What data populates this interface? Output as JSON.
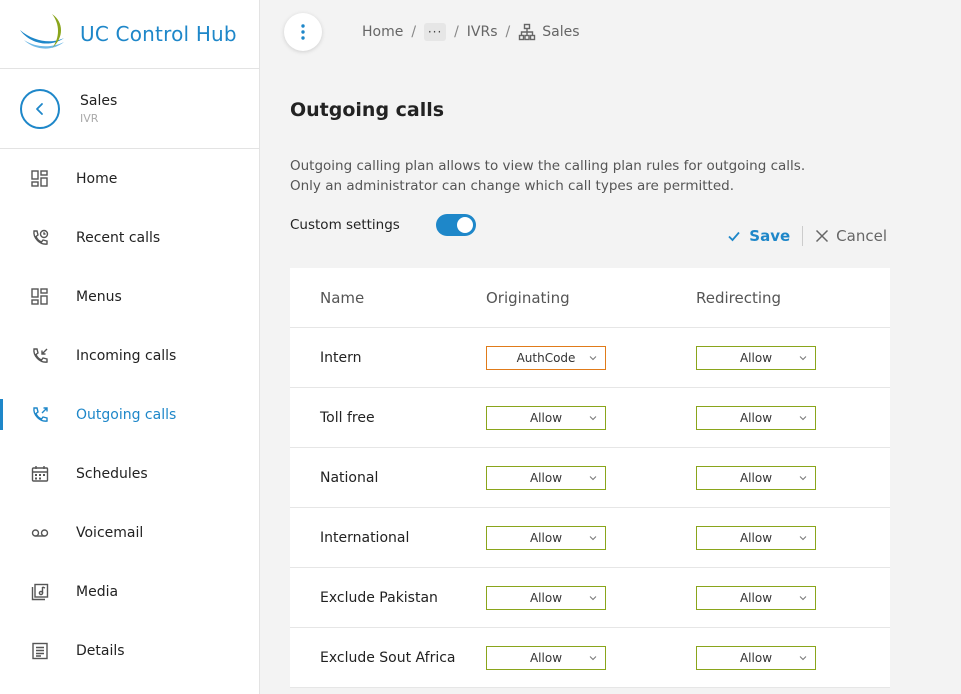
{
  "app": {
    "title": "UC Control Hub"
  },
  "context": {
    "title": "Sales",
    "subtitle": "IVR"
  },
  "nav": [
    {
      "label": "Home",
      "icon": "dashboard-icon",
      "active": false
    },
    {
      "label": "Recent calls",
      "icon": "phone-clock-icon",
      "active": false
    },
    {
      "label": "Menus",
      "icon": "dashboard-icon",
      "active": false
    },
    {
      "label": "Incoming calls",
      "icon": "phone-incoming-icon",
      "active": false
    },
    {
      "label": "Outgoing calls",
      "icon": "phone-outgoing-icon",
      "active": true
    },
    {
      "label": "Schedules",
      "icon": "calendar-icon",
      "active": false
    },
    {
      "label": "Voicemail",
      "icon": "voicemail-icon",
      "active": false
    },
    {
      "label": "Media",
      "icon": "media-icon",
      "active": false
    },
    {
      "label": "Details",
      "icon": "details-icon",
      "active": false
    }
  ],
  "breadcrumb": {
    "home": "Home",
    "more": "···",
    "ivrs": "IVRs",
    "current": "Sales"
  },
  "page": {
    "title": "Outgoing calls",
    "description_line1": "Outgoing calling plan allows to view the calling plan rules for outgoing calls.",
    "description_line2": "Only an administrator can change which call types are permitted.",
    "custom_settings_label": "Custom settings",
    "custom_settings_on": true,
    "save_label": "Save",
    "cancel_label": "Cancel"
  },
  "table": {
    "headers": [
      "Name",
      "Originating",
      "Redirecting"
    ],
    "rows": [
      {
        "name": "Intern",
        "originating": "AuthCode",
        "redirecting": "Allow"
      },
      {
        "name": "Toll free",
        "originating": "Allow",
        "redirecting": "Allow"
      },
      {
        "name": "National",
        "originating": "Allow",
        "redirecting": "Allow"
      },
      {
        "name": "International",
        "originating": "Allow",
        "redirecting": "Allow"
      },
      {
        "name": "Exclude Pakistan",
        "originating": "Allow",
        "redirecting": "Allow"
      },
      {
        "name": "Exclude Sout Africa",
        "originating": "Allow",
        "redirecting": "Allow"
      }
    ]
  },
  "colors": {
    "accent": "#1e87c9",
    "allow_border": "#8aa51c",
    "authcode_border": "#e07b1a"
  }
}
